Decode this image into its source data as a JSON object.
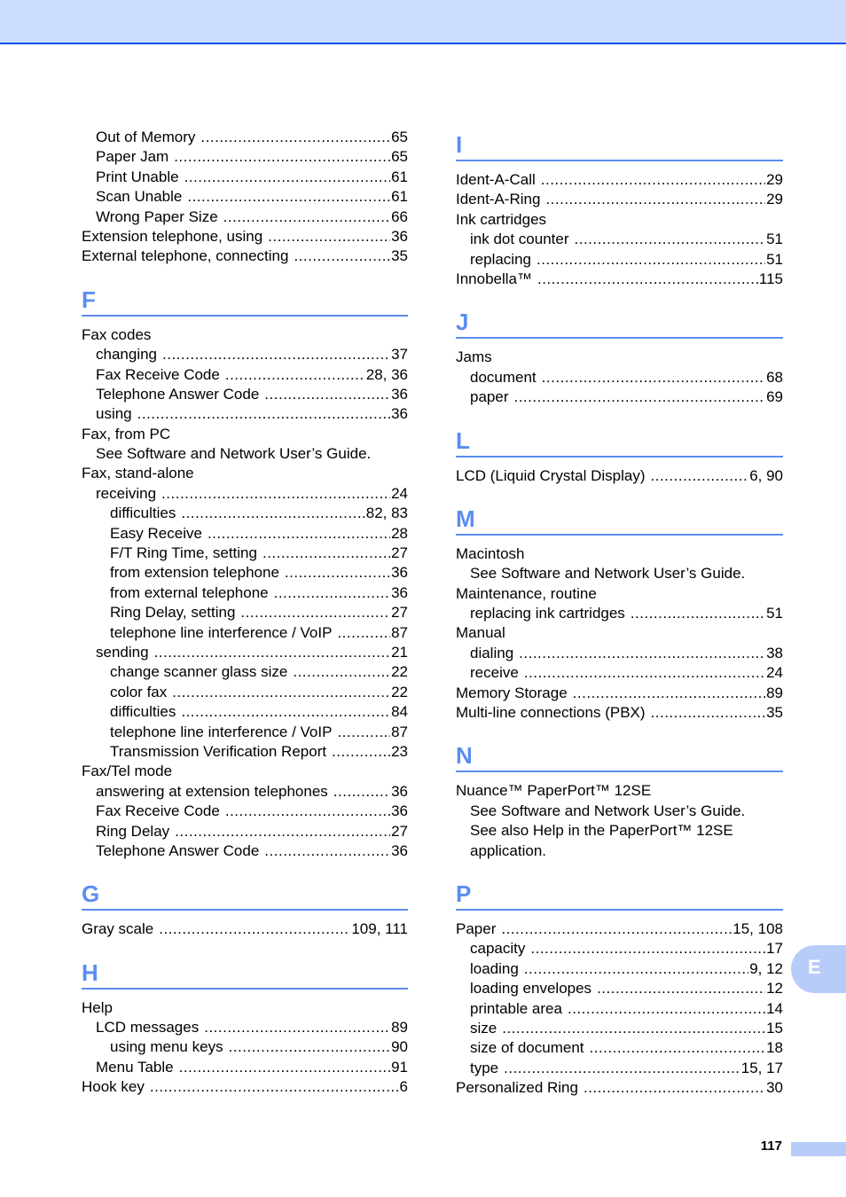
{
  "left_column": [
    {
      "type": "entry",
      "level": 1,
      "term": "Out of Memory",
      "page": "65"
    },
    {
      "type": "entry",
      "level": 1,
      "term": "Paper Jam",
      "page": "65"
    },
    {
      "type": "entry",
      "level": 1,
      "term": "Print Unable",
      "page": "61"
    },
    {
      "type": "entry",
      "level": 1,
      "term": "Scan Unable",
      "page": "61"
    },
    {
      "type": "entry",
      "level": 1,
      "term": "Wrong Paper Size",
      "page": "66"
    },
    {
      "type": "entry",
      "level": 0,
      "term": "Extension telephone, using",
      "page": "36"
    },
    {
      "type": "entry",
      "level": 0,
      "term": "External telephone, connecting",
      "page": "35"
    },
    {
      "type": "heading",
      "letter": "F"
    },
    {
      "type": "entry",
      "level": 0,
      "term": "Fax codes",
      "page": ""
    },
    {
      "type": "entry",
      "level": 1,
      "term": "changing",
      "page": "37"
    },
    {
      "type": "entry",
      "level": 1,
      "term": "Fax Receive Code",
      "page": "28, 36"
    },
    {
      "type": "entry",
      "level": 1,
      "term": "Telephone Answer Code",
      "page": "36"
    },
    {
      "type": "entry",
      "level": 1,
      "term": "using",
      "page": "36"
    },
    {
      "type": "entry",
      "level": 0,
      "term": "Fax, from PC",
      "page": ""
    },
    {
      "type": "entry",
      "level": 1,
      "term": "See Software and Network User’s Guide.",
      "page": ""
    },
    {
      "type": "entry",
      "level": 0,
      "term": "Fax, stand-alone",
      "page": ""
    },
    {
      "type": "entry",
      "level": 1,
      "term": "receiving",
      "page": "24"
    },
    {
      "type": "entry",
      "level": 2,
      "term": "difficulties",
      "page": "82, 83"
    },
    {
      "type": "entry",
      "level": 2,
      "term": "Easy Receive",
      "page": "28"
    },
    {
      "type": "entry",
      "level": 2,
      "term": "F/T Ring Time, setting",
      "page": "27"
    },
    {
      "type": "entry",
      "level": 2,
      "term": "from extension telephone",
      "page": "36"
    },
    {
      "type": "entry",
      "level": 2,
      "term": "from external telephone",
      "page": "36"
    },
    {
      "type": "entry",
      "level": 2,
      "term": "Ring Delay, setting",
      "page": "27"
    },
    {
      "type": "entry",
      "level": 2,
      "term": "telephone line interference / VoIP",
      "page": "87"
    },
    {
      "type": "entry",
      "level": 1,
      "term": "sending",
      "page": "21"
    },
    {
      "type": "entry",
      "level": 2,
      "term": "change scanner glass size",
      "page": "22"
    },
    {
      "type": "entry",
      "level": 2,
      "term": "color fax",
      "page": "22"
    },
    {
      "type": "entry",
      "level": 2,
      "term": "difficulties",
      "page": "84"
    },
    {
      "type": "entry",
      "level": 2,
      "term": "telephone line interference / VoIP",
      "page": "87"
    },
    {
      "type": "entry",
      "level": 2,
      "term": "Transmission Verification Report",
      "page": "23"
    },
    {
      "type": "entry",
      "level": 0,
      "term": "Fax/Tel mode",
      "page": ""
    },
    {
      "type": "entry",
      "level": 1,
      "term": "answering at extension telephones",
      "page": "36"
    },
    {
      "type": "entry",
      "level": 1,
      "term": "Fax Receive Code",
      "page": "36"
    },
    {
      "type": "entry",
      "level": 1,
      "term": "Ring Delay",
      "page": "27"
    },
    {
      "type": "entry",
      "level": 1,
      "term": "Telephone Answer Code",
      "page": "36"
    },
    {
      "type": "heading",
      "letter": "G"
    },
    {
      "type": "entry",
      "level": 0,
      "term": "Gray scale",
      "page": "109, 111"
    },
    {
      "type": "heading",
      "letter": "H"
    },
    {
      "type": "entry",
      "level": 0,
      "term": "Help",
      "page": ""
    },
    {
      "type": "entry",
      "level": 1,
      "term": "LCD messages",
      "page": "89"
    },
    {
      "type": "entry",
      "level": 2,
      "term": "using menu keys",
      "page": "90"
    },
    {
      "type": "entry",
      "level": 1,
      "term": "Menu Table",
      "page": "91"
    },
    {
      "type": "entry",
      "level": 0,
      "term": "Hook key",
      "page": "6"
    }
  ],
  "right_column": [
    {
      "type": "heading",
      "letter": "I"
    },
    {
      "type": "entry",
      "level": 0,
      "term": "Ident-A-Call",
      "page": "29"
    },
    {
      "type": "entry",
      "level": 0,
      "term": "Ident-A-Ring",
      "page": "29"
    },
    {
      "type": "entry",
      "level": 0,
      "term": "Ink cartridges",
      "page": ""
    },
    {
      "type": "entry",
      "level": 1,
      "term": "ink dot counter",
      "page": "51"
    },
    {
      "type": "entry",
      "level": 1,
      "term": "replacing",
      "page": "51"
    },
    {
      "type": "entry",
      "level": 0,
      "term": "Innobella™",
      "page": "115"
    },
    {
      "type": "heading",
      "letter": "J"
    },
    {
      "type": "entry",
      "level": 0,
      "term": "Jams",
      "page": ""
    },
    {
      "type": "entry",
      "level": 1,
      "term": "document",
      "page": "68"
    },
    {
      "type": "entry",
      "level": 1,
      "term": "paper",
      "page": "69"
    },
    {
      "type": "heading",
      "letter": "L"
    },
    {
      "type": "entry",
      "level": 0,
      "term": "LCD (Liquid Crystal Display)",
      "page": "6, 90"
    },
    {
      "type": "heading",
      "letter": "M"
    },
    {
      "type": "entry",
      "level": 0,
      "term": "Macintosh",
      "page": ""
    },
    {
      "type": "entry",
      "level": 1,
      "term": "See Software and Network User’s Guide.",
      "page": ""
    },
    {
      "type": "entry",
      "level": 0,
      "term": "Maintenance, routine",
      "page": ""
    },
    {
      "type": "entry",
      "level": 1,
      "term": "replacing ink cartridges",
      "page": "51"
    },
    {
      "type": "entry",
      "level": 0,
      "term": "Manual",
      "page": ""
    },
    {
      "type": "entry",
      "level": 1,
      "term": "dialing",
      "page": "38"
    },
    {
      "type": "entry",
      "level": 1,
      "term": "receive",
      "page": "24"
    },
    {
      "type": "entry",
      "level": 0,
      "term": "Memory Storage",
      "page": "89"
    },
    {
      "type": "entry",
      "level": 0,
      "term": "Multi-line connections (PBX)",
      "page": "35"
    },
    {
      "type": "heading",
      "letter": "N"
    },
    {
      "type": "entry",
      "level": 0,
      "term": "Nuance™ PaperPort™ 12SE",
      "page": ""
    },
    {
      "type": "entry",
      "level": 1,
      "term": "See Software and Network User’s Guide.",
      "page": ""
    },
    {
      "type": "entry",
      "level": 1,
      "term": "See also Help in the PaperPort™ 12SE",
      "page": ""
    },
    {
      "type": "entry",
      "level": 1,
      "term": "application.",
      "page": ""
    },
    {
      "type": "heading",
      "letter": "P"
    },
    {
      "type": "entry",
      "level": 0,
      "term": "Paper",
      "page": "15, 108"
    },
    {
      "type": "entry",
      "level": 1,
      "term": "capacity",
      "page": "17"
    },
    {
      "type": "entry",
      "level": 1,
      "term": "loading",
      "page": "9, 12"
    },
    {
      "type": "entry",
      "level": 1,
      "term": "loading envelopes",
      "page": "12"
    },
    {
      "type": "entry",
      "level": 1,
      "term": "printable area",
      "page": "14"
    },
    {
      "type": "entry",
      "level": 1,
      "term": "size",
      "page": "15"
    },
    {
      "type": "entry",
      "level": 1,
      "term": "size of document",
      "page": "18"
    },
    {
      "type": "entry",
      "level": 1,
      "term": "type",
      "page": "15, 17"
    },
    {
      "type": "entry",
      "level": 0,
      "term": "Personalized Ring",
      "page": "30"
    }
  ],
  "side_tab": {
    "label": "E"
  },
  "footer": {
    "page_number": "117"
  },
  "colors": {
    "accent": "#5b8def",
    "header_band": "#ccdcff",
    "header_rule": "#0050e6",
    "tab": "#b8ccfa"
  }
}
